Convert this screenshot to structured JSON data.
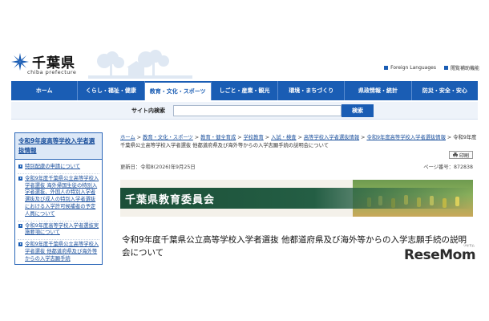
{
  "header": {
    "logo_text": "千葉県",
    "logo_sub": "chiba prefecture",
    "links": [
      {
        "label": "Foreign Languages"
      },
      {
        "label": "閲覧補助機能"
      }
    ]
  },
  "nav": {
    "items": [
      {
        "label": "ホーム"
      },
      {
        "label": "くらし・福祉・健康"
      },
      {
        "label": "教育・文化・スポーツ"
      },
      {
        "label": "しごと・産業・観光"
      },
      {
        "label": "環境・まちづくり"
      },
      {
        "label": "県政情報・統計"
      },
      {
        "label": "防災・安全・安心"
      }
    ],
    "active_index": 2
  },
  "search": {
    "label": "サイト内検索",
    "placeholder": "",
    "button_label": "検索"
  },
  "sidebar": {
    "title": "令和9年度高等学校入学者選抜情報",
    "items": [
      {
        "label": "特別配慮の申請について"
      },
      {
        "label": "令和9年度千葉県公立高等学校入学者選抜 海外帰国生徒の特別入学者選抜、外国人の特別入学者選抜及び成人の特別入学者選抜における入学許可候補者の予定人員について"
      },
      {
        "label": "令和9年度高等学校入学者選抜実施要項について"
      },
      {
        "label": "令和9年度千葉県公立高等学校入学者選抜 他都道府県及び海外等からの入学志願手続"
      }
    ]
  },
  "breadcrumb": {
    "items": [
      {
        "label": "ホーム"
      },
      {
        "label": "教育・文化・スポーツ"
      },
      {
        "label": "教育・健全育成"
      },
      {
        "label": "学校教育"
      },
      {
        "label": "入試・検査"
      },
      {
        "label": "高等学校入学者選抜情報"
      },
      {
        "label": "令和9年度高等学校入学者選抜情報"
      }
    ],
    "separator": ">",
    "current": "令和9年度千葉県公立高等学校入学者選抜 他都道府県及び海外等からの入学志願手続の説明会について"
  },
  "print_label": "印刷",
  "meta": {
    "updated": "更新日：令和8(2026)年9月25日",
    "page_id": "ページ番号：872838"
  },
  "banner": {
    "title": "千葉県教育委員会"
  },
  "page": {
    "heading": "令和9年度千葉県公立高等学校入学者選抜 他都道府県及び海外等からの入学志願手続の説明会について"
  },
  "watermark": {
    "text": "ReseMom",
    "tiny": "リセマム"
  },
  "colors": {
    "brand_blue": "#1a5db4",
    "banner_green": "#1b4f38"
  }
}
